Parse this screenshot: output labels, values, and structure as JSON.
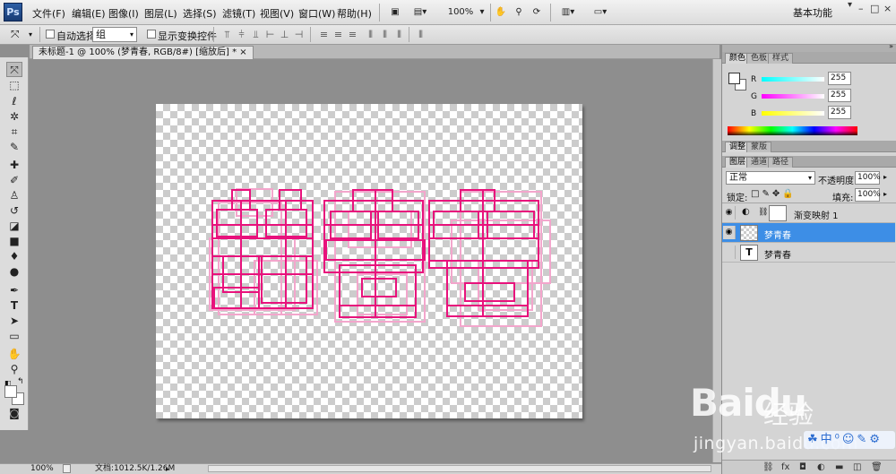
{
  "app": {
    "logo": "Ps"
  },
  "menubar": {
    "items": [
      "文件(F)",
      "编辑(E)",
      "图像(I)",
      "图层(L)",
      "选择(S)",
      "滤镜(T)",
      "视图(V)",
      "窗口(W)",
      "帮助(H)"
    ],
    "zoom": "100%",
    "workspace": "基本功能",
    "window_buttons": [
      "–",
      "□",
      "×"
    ]
  },
  "options": {
    "auto_select_label": "自动选择:",
    "auto_select_value": "组",
    "show_transform_label": "显示变换控件"
  },
  "document": {
    "tab_title": "未标题-1 @ 100% (梦青春, RGB/8#) [缩放后] *"
  },
  "toolbox": {
    "tools": [
      "move-tool",
      "marquee-tool",
      "lasso-tool",
      "magic-wand-tool",
      "crop-tool",
      "eyedropper-tool",
      "healing-tool",
      "brush-tool",
      "clone-stamp-tool",
      "history-brush-tool",
      "eraser-tool",
      "gradient-tool",
      "blur-tool",
      "dodge-tool",
      "pen-tool",
      "type-tool",
      "path-selection-tool",
      "shape-tool",
      "hand-tool",
      "zoom-tool"
    ]
  },
  "panels": {
    "color": {
      "tabs": [
        "颜色",
        "色板",
        "样式"
      ],
      "r_label": "R",
      "g_label": "G",
      "b_label": "B",
      "r": "255",
      "g": "255",
      "b": "255"
    },
    "adjust": {
      "tabs": [
        "调整",
        "蒙版"
      ]
    },
    "layers": {
      "tabs": [
        "图层",
        "通道",
        "路径"
      ],
      "blend_mode": "正常",
      "opacity_label": "不透明度:",
      "opacity": "100%",
      "lock_label": "锁定:",
      "fill_label": "填充:",
      "fill": "100%",
      "items": [
        {
          "name": "渐变映射 1",
          "visible": true,
          "selected": false
        },
        {
          "name": "梦青春",
          "visible": true,
          "selected": true
        },
        {
          "name": "梦青春",
          "visible": false,
          "selected": false
        }
      ],
      "text_thumb": "T"
    }
  },
  "status": {
    "zoom": "100%",
    "doc_info": "文档:1012.5K/1.26M"
  },
  "watermark": {
    "brand": "Baidu",
    "brand_cn": "经验",
    "url": "jingyan.baidu.com"
  },
  "colors": {
    "accent_selected": "#3d8ee6",
    "pink": "#e8127c",
    "light_pink": "#f3a6cc"
  }
}
